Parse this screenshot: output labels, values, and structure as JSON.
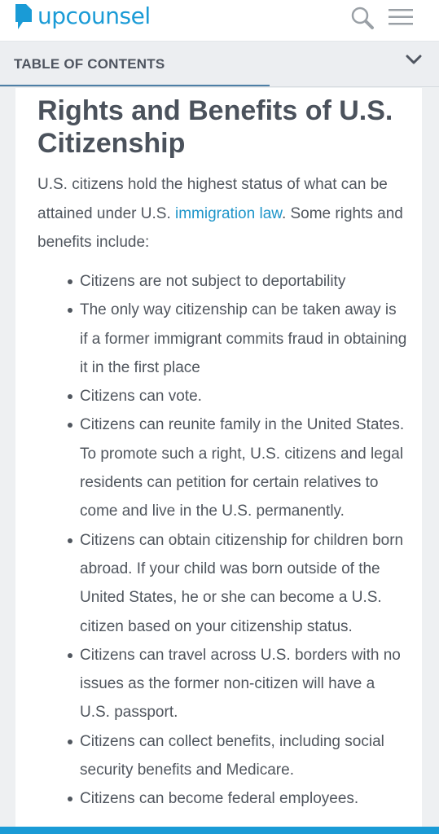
{
  "header": {
    "logo_text": "upcounsel",
    "icons": {
      "search": "search-icon",
      "menu": "hamburger-menu-icon",
      "logo": "logo-icon"
    }
  },
  "toc": {
    "label": "TABLE OF CONTENTS",
    "icon": "chevron-down-icon"
  },
  "article": {
    "title": "Rights and Benefits of U.S. Citizenship",
    "intro_before": "U.S. citizens hold the highest status of what can be attained under U.S. ",
    "intro_link": "immigration law",
    "intro_after": ". Some rights and benefits include:",
    "benefits": [
      "Citizens are not subject to deportability",
      "The only way citizenship can be taken away is if a former immigrant commits fraud in obtaining it in the first place",
      "Citizens can vote.",
      "Citizens can reunite family in the United States. To promote such a right, U.S. citizens and legal residents can petition for certain relatives to come and live in the U.S. permanently.",
      "Citizens can obtain citizenship for children born abroad. If your child was born outside of the United States, he or she can become a U.S. citizen based on your citizenship status.",
      "Citizens can travel across U.S. borders with no issues as the former non-citizen will have a U.S. passport.",
      "Citizens can collect benefits, including social security benefits and Medicare.",
      "Citizens can become federal employees."
    ]
  },
  "colors": {
    "brand": "#1a9bd6",
    "link": "#1e95c9",
    "text": "#50565e",
    "heading": "#4b525c",
    "toc_background": "#eceef1"
  }
}
